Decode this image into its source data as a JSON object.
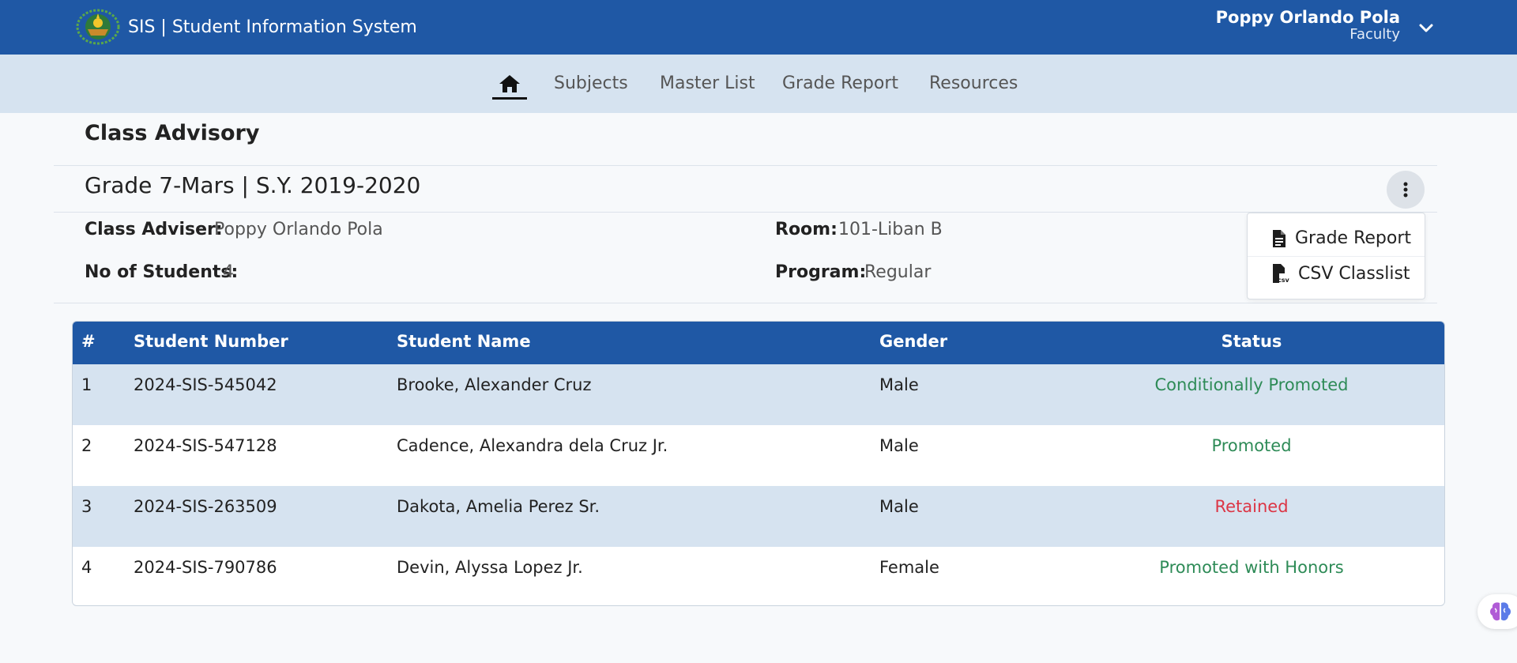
{
  "app": {
    "title": "SIS | Student Information System",
    "logo_icon": "school-seal-logo"
  },
  "user": {
    "name": "Poppy Orlando Pola",
    "role": "Faculty"
  },
  "nav": {
    "home_icon": "home-icon",
    "items": [
      "Subjects",
      "Master List",
      "Grade Report",
      "Resources"
    ]
  },
  "page": {
    "section_title": "Class Advisory",
    "class_title": "Grade 7-Mars | S.Y. 2019-2020",
    "info": {
      "adviser_label": "Class Adviser:",
      "adviser_value": "Poppy Orlando Pola",
      "students_label": "No of Students:",
      "students_value": "4",
      "room_label": "Room:",
      "room_value": "101-Liban B",
      "program_label": "Program:",
      "program_value": "Regular"
    }
  },
  "menu": {
    "items": [
      {
        "label": "Grade Report",
        "icon": "file-text-icon"
      },
      {
        "label": "CSV Classlist",
        "icon": "file-csv-icon"
      }
    ]
  },
  "table": {
    "headers": [
      "#",
      "Student Number",
      "Student Name",
      "Gender",
      "Status"
    ],
    "rows": [
      {
        "num": "1",
        "student_number": "2024-SIS-545042",
        "name": "Brooke, Alexander Cruz",
        "gender": "Male",
        "status": "Conditionally Promoted",
        "status_color": "#2e8b57"
      },
      {
        "num": "2",
        "student_number": "2024-SIS-547128",
        "name": "Cadence, Alexandra dela Cruz Jr.",
        "gender": "Male",
        "status": "Promoted",
        "status_color": "#2e8b57"
      },
      {
        "num": "3",
        "student_number": "2024-SIS-263509",
        "name": "Dakota, Amelia Perez Sr.",
        "gender": "Male",
        "status": "Retained",
        "status_color": "#dc3545"
      },
      {
        "num": "4",
        "student_number": "2024-SIS-790786",
        "name": "Devin, Alyssa Lopez Jr.",
        "gender": "Female",
        "status": "Promoted with Honors",
        "status_color": "#2e8b57"
      }
    ]
  },
  "colors": {
    "primary": "#1f58a5",
    "nav_bg": "#d6e3f0",
    "row_shade": "#d6e3f0",
    "success": "#2e8b57",
    "danger": "#dc3545"
  }
}
